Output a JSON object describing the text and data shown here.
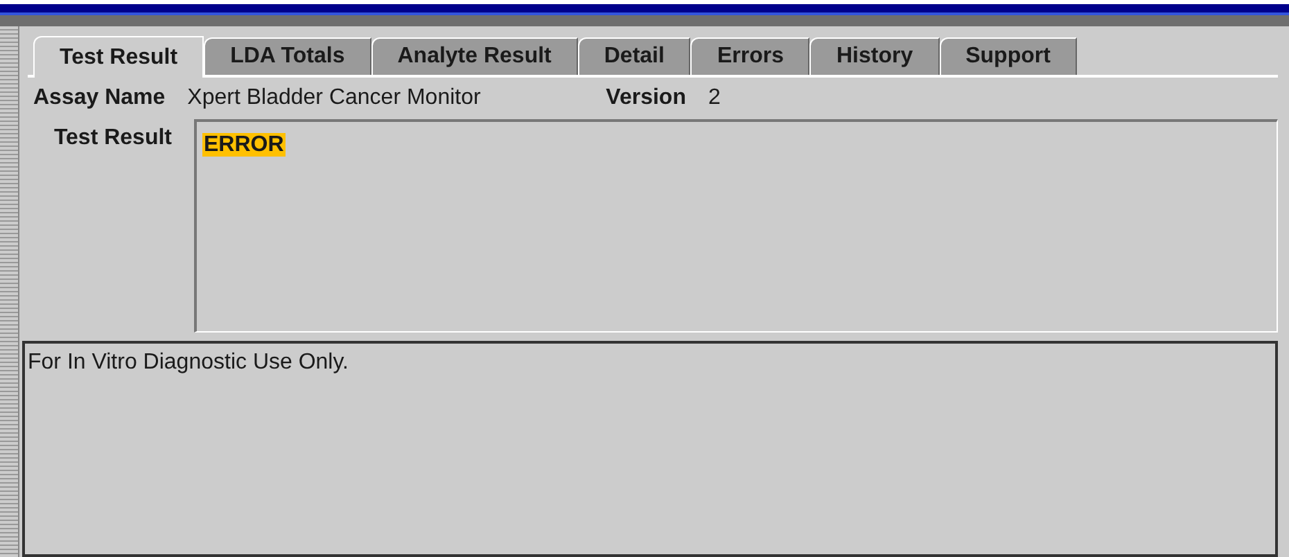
{
  "tabs": [
    {
      "label": "Test Result",
      "selected": true
    },
    {
      "label": "LDA Totals",
      "selected": false
    },
    {
      "label": "Analyte Result",
      "selected": false
    },
    {
      "label": "Detail",
      "selected": false
    },
    {
      "label": "Errors",
      "selected": false
    },
    {
      "label": "History",
      "selected": false
    },
    {
      "label": "Support",
      "selected": false
    }
  ],
  "assay_name": {
    "label": "Assay Name",
    "value": "Xpert Bladder Cancer Monitor"
  },
  "version": {
    "label": "Version",
    "value": "2"
  },
  "test_result": {
    "label": "Test Result",
    "value": "ERROR",
    "highlighted": true
  },
  "disclaimer": "For In Vitro Diagnostic Use Only."
}
